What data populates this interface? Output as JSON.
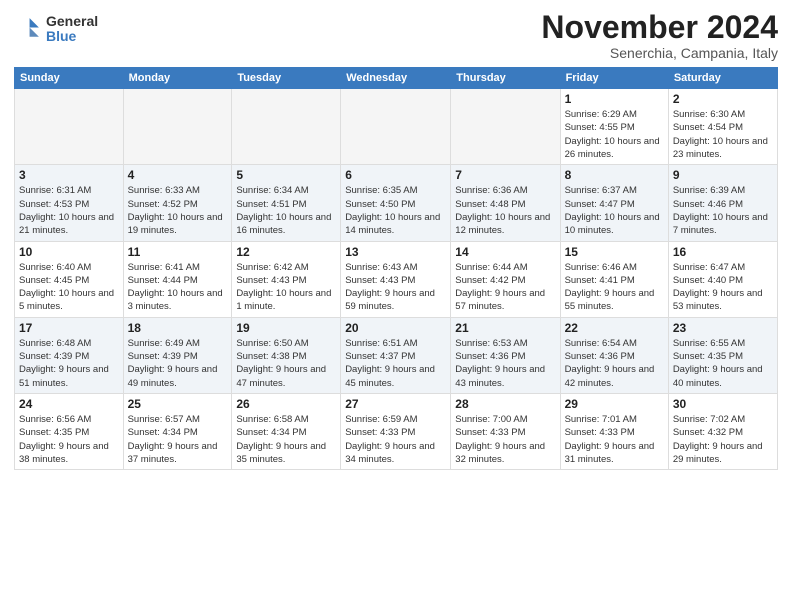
{
  "header": {
    "logo_general": "General",
    "logo_blue": "Blue",
    "month_title": "November 2024",
    "subtitle": "Senerchia, Campania, Italy"
  },
  "days_of_week": [
    "Sunday",
    "Monday",
    "Tuesday",
    "Wednesday",
    "Thursday",
    "Friday",
    "Saturday"
  ],
  "weeks": [
    {
      "cells": [
        {
          "day": "",
          "info": ""
        },
        {
          "day": "",
          "info": ""
        },
        {
          "day": "",
          "info": ""
        },
        {
          "day": "",
          "info": ""
        },
        {
          "day": "",
          "info": ""
        },
        {
          "day": "1",
          "info": "Sunrise: 6:29 AM\nSunset: 4:55 PM\nDaylight: 10 hours\nand 26 minutes."
        },
        {
          "day": "2",
          "info": "Sunrise: 6:30 AM\nSunset: 4:54 PM\nDaylight: 10 hours\nand 23 minutes."
        }
      ]
    },
    {
      "cells": [
        {
          "day": "3",
          "info": "Sunrise: 6:31 AM\nSunset: 4:53 PM\nDaylight: 10 hours\nand 21 minutes."
        },
        {
          "day": "4",
          "info": "Sunrise: 6:33 AM\nSunset: 4:52 PM\nDaylight: 10 hours\nand 19 minutes."
        },
        {
          "day": "5",
          "info": "Sunrise: 6:34 AM\nSunset: 4:51 PM\nDaylight: 10 hours\nand 16 minutes."
        },
        {
          "day": "6",
          "info": "Sunrise: 6:35 AM\nSunset: 4:50 PM\nDaylight: 10 hours\nand 14 minutes."
        },
        {
          "day": "7",
          "info": "Sunrise: 6:36 AM\nSunset: 4:48 PM\nDaylight: 10 hours\nand 12 minutes."
        },
        {
          "day": "8",
          "info": "Sunrise: 6:37 AM\nSunset: 4:47 PM\nDaylight: 10 hours\nand 10 minutes."
        },
        {
          "day": "9",
          "info": "Sunrise: 6:39 AM\nSunset: 4:46 PM\nDaylight: 10 hours\nand 7 minutes."
        }
      ]
    },
    {
      "cells": [
        {
          "day": "10",
          "info": "Sunrise: 6:40 AM\nSunset: 4:45 PM\nDaylight: 10 hours\nand 5 minutes."
        },
        {
          "day": "11",
          "info": "Sunrise: 6:41 AM\nSunset: 4:44 PM\nDaylight: 10 hours\nand 3 minutes."
        },
        {
          "day": "12",
          "info": "Sunrise: 6:42 AM\nSunset: 4:43 PM\nDaylight: 10 hours\nand 1 minute."
        },
        {
          "day": "13",
          "info": "Sunrise: 6:43 AM\nSunset: 4:43 PM\nDaylight: 9 hours\nand 59 minutes."
        },
        {
          "day": "14",
          "info": "Sunrise: 6:44 AM\nSunset: 4:42 PM\nDaylight: 9 hours\nand 57 minutes."
        },
        {
          "day": "15",
          "info": "Sunrise: 6:46 AM\nSunset: 4:41 PM\nDaylight: 9 hours\nand 55 minutes."
        },
        {
          "day": "16",
          "info": "Sunrise: 6:47 AM\nSunset: 4:40 PM\nDaylight: 9 hours\nand 53 minutes."
        }
      ]
    },
    {
      "cells": [
        {
          "day": "17",
          "info": "Sunrise: 6:48 AM\nSunset: 4:39 PM\nDaylight: 9 hours\nand 51 minutes."
        },
        {
          "day": "18",
          "info": "Sunrise: 6:49 AM\nSunset: 4:39 PM\nDaylight: 9 hours\nand 49 minutes."
        },
        {
          "day": "19",
          "info": "Sunrise: 6:50 AM\nSunset: 4:38 PM\nDaylight: 9 hours\nand 47 minutes."
        },
        {
          "day": "20",
          "info": "Sunrise: 6:51 AM\nSunset: 4:37 PM\nDaylight: 9 hours\nand 45 minutes."
        },
        {
          "day": "21",
          "info": "Sunrise: 6:53 AM\nSunset: 4:36 PM\nDaylight: 9 hours\nand 43 minutes."
        },
        {
          "day": "22",
          "info": "Sunrise: 6:54 AM\nSunset: 4:36 PM\nDaylight: 9 hours\nand 42 minutes."
        },
        {
          "day": "23",
          "info": "Sunrise: 6:55 AM\nSunset: 4:35 PM\nDaylight: 9 hours\nand 40 minutes."
        }
      ]
    },
    {
      "cells": [
        {
          "day": "24",
          "info": "Sunrise: 6:56 AM\nSunset: 4:35 PM\nDaylight: 9 hours\nand 38 minutes."
        },
        {
          "day": "25",
          "info": "Sunrise: 6:57 AM\nSunset: 4:34 PM\nDaylight: 9 hours\nand 37 minutes."
        },
        {
          "day": "26",
          "info": "Sunrise: 6:58 AM\nSunset: 4:34 PM\nDaylight: 9 hours\nand 35 minutes."
        },
        {
          "day": "27",
          "info": "Sunrise: 6:59 AM\nSunset: 4:33 PM\nDaylight: 9 hours\nand 34 minutes."
        },
        {
          "day": "28",
          "info": "Sunrise: 7:00 AM\nSunset: 4:33 PM\nDaylight: 9 hours\nand 32 minutes."
        },
        {
          "day": "29",
          "info": "Sunrise: 7:01 AM\nSunset: 4:33 PM\nDaylight: 9 hours\nand 31 minutes."
        },
        {
          "day": "30",
          "info": "Sunrise: 7:02 AM\nSunset: 4:32 PM\nDaylight: 9 hours\nand 29 minutes."
        }
      ]
    }
  ]
}
